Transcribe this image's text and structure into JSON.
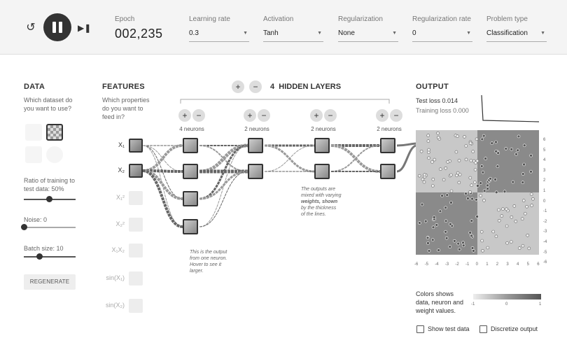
{
  "controls": {
    "epoch_label": "Epoch",
    "epoch_value": "002,235",
    "learning_rate": {
      "label": "Learning rate",
      "value": "0.3"
    },
    "activation": {
      "label": "Activation",
      "value": "Tanh"
    },
    "regularization": {
      "label": "Regularization",
      "value": "None"
    },
    "regularization_rate": {
      "label": "Regularization rate",
      "value": "0"
    },
    "problem_type": {
      "label": "Problem type",
      "value": "Classification"
    }
  },
  "data": {
    "title": "DATA",
    "prompt": [
      "Which dataset do",
      "you want to use?"
    ],
    "ratio_label": [
      "Ratio of training to",
      "test data:  50%"
    ],
    "ratio_value": 0.5,
    "noise_label": "Noise:  0",
    "noise_value": 0,
    "batch_label": "Batch size:  10",
    "batch_value": 10,
    "regenerate": "REGENERATE"
  },
  "features": {
    "title": "FEATURES",
    "prompt": [
      "Which properties",
      "do you want to",
      "feed in?"
    ],
    "items": [
      {
        "label": "X₁",
        "enabled": true
      },
      {
        "label": "X₂",
        "enabled": true
      },
      {
        "label": "X₁²",
        "enabled": false
      },
      {
        "label": "X₂²",
        "enabled": false
      },
      {
        "label": "X₁X₂",
        "enabled": false
      },
      {
        "label": "sin(X₁)",
        "enabled": false
      },
      {
        "label": "sin(X₂)",
        "enabled": false
      }
    ]
  },
  "network": {
    "layer_count": "4",
    "title": "HIDDEN LAYERS",
    "layers": [
      {
        "neurons_label": "4 neurons",
        "count": 4
      },
      {
        "neurons_label": "2 neurons",
        "count": 2
      },
      {
        "neurons_label": "2 neurons",
        "count": 2
      },
      {
        "neurons_label": "2 neurons",
        "count": 2
      }
    ],
    "note_weights": [
      "The outputs are",
      "mixed with varying",
      "weights, shown",
      "by the thickness",
      "of the lines."
    ],
    "note_neuron": [
      "This is the output",
      "from one neuron.",
      "Hover to see it",
      "larger."
    ]
  },
  "output": {
    "title": "OUTPUT",
    "test_loss": "Test loss 0.014",
    "training_loss": "Training loss 0.000",
    "x_ticks": [
      "-6",
      "-5",
      "-4",
      "-3",
      "-2",
      "-1",
      "0",
      "1",
      "2",
      "3",
      "4",
      "5",
      "6"
    ],
    "y_ticks": [
      "6",
      "5",
      "4",
      "3",
      "2",
      "1",
      "0",
      "-1",
      "-2",
      "-3",
      "-4",
      "-5",
      "-6"
    ],
    "legend_text": [
      "Colors shows",
      "data, neuron and",
      "weight values."
    ],
    "colorbar_ticks": [
      "-1",
      "0",
      "1"
    ],
    "show_test_data": "Show test data",
    "discretize_output": "Discretize output"
  }
}
